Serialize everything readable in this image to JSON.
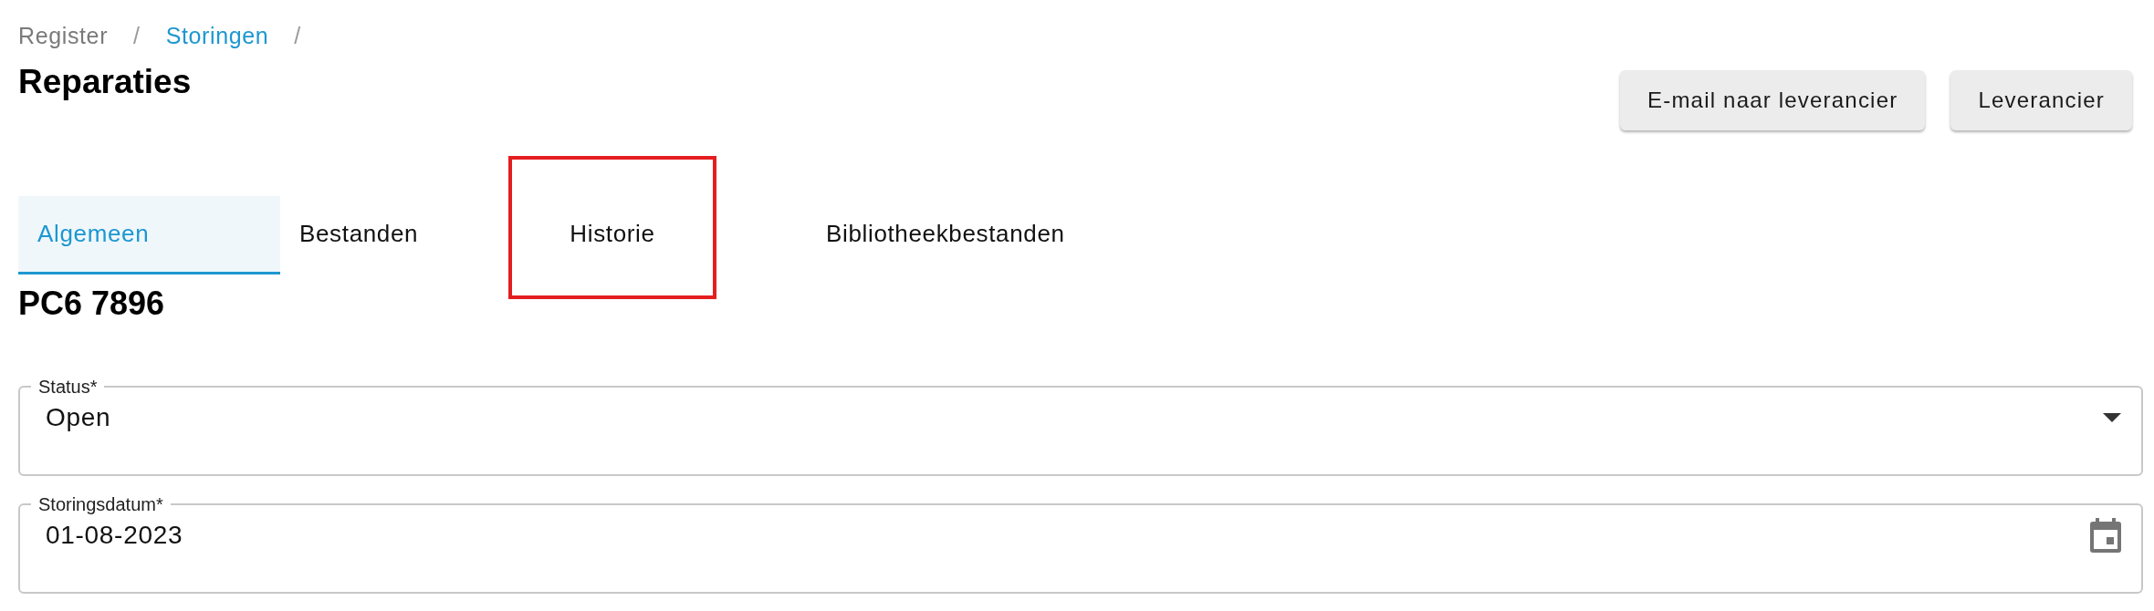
{
  "breadcrumb": [
    {
      "label": "Register",
      "link": false
    },
    {
      "label": "Storingen",
      "link": true
    }
  ],
  "separator": "/",
  "title": "Reparaties",
  "buttons": [
    "E-mail naar leverancier",
    "Leverancier"
  ],
  "tabs": [
    {
      "label": "Algemeen",
      "selected": true,
      "highlighted": false
    },
    {
      "label": "Bestanden",
      "selected": false,
      "highlighted": false
    },
    {
      "label": "Historie",
      "selected": false,
      "highlighted": true
    },
    {
      "label": "Bibliotheekbestanden",
      "selected": false,
      "highlighted": false
    }
  ],
  "record": "PC6 7896",
  "fields": [
    {
      "kind": "select",
      "label": "Status*",
      "value": "Open"
    },
    {
      "kind": "date",
      "label": "Storingsdatum*",
      "value": "01-08-2023"
    }
  ]
}
